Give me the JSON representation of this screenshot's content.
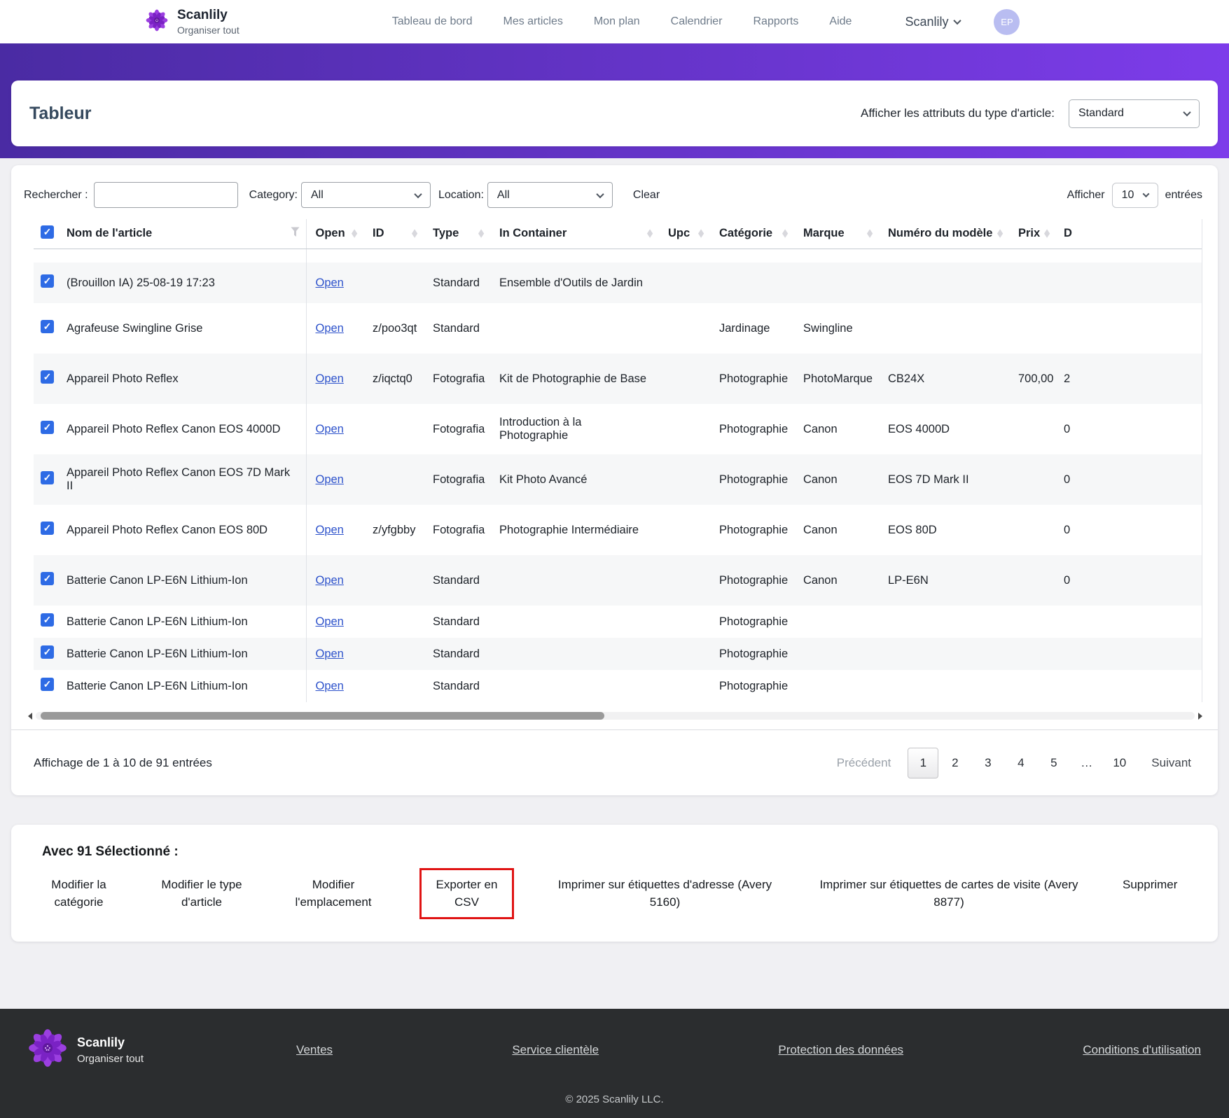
{
  "header": {
    "brand": {
      "name": "Scanlily",
      "tagline": "Organiser tout"
    },
    "nav": [
      "Tableau de bord",
      "Mes articles",
      "Mon plan",
      "Calendrier",
      "Rapports",
      "Aide"
    ],
    "account_menu": "Scanlily",
    "avatar_initials": "EP"
  },
  "page": {
    "title": "Tableur",
    "attribute_filter_label": "Afficher les attributs du type d'article:",
    "attribute_filter_value": "Standard"
  },
  "filters": {
    "search_label": "Rechercher :",
    "search_value": "",
    "category_label": "Category:",
    "category_value": "All",
    "location_label": "Location:",
    "location_value": "All",
    "clear_label": "Clear",
    "show_label": "Afficher",
    "show_value": "10",
    "entries_label": "entrées"
  },
  "table": {
    "head": {
      "name": "Nom de l'article",
      "open": "Open",
      "id": "ID",
      "type": "Type",
      "container": "In Container",
      "upc": "Upc",
      "category": "Catégorie",
      "brand": "Marque",
      "model": "Numéro du modèle",
      "price": "Prix",
      "d": "D"
    },
    "open_label": "Open",
    "rows": [
      {
        "name": "(Brouillon IA) 25-08-19 17:23",
        "id": "",
        "type": "Standard",
        "container": "Ensemble d'Outils de Jardin",
        "upc": "",
        "category": "",
        "brand": "",
        "model": "",
        "price": "",
        "d": ""
      },
      {
        "name": "Agrafeuse Swingline Grise",
        "id": "z/poo3qt",
        "type": "Standard",
        "container": "",
        "upc": "",
        "category": "Jardinage",
        "brand": "Swingline",
        "model": "",
        "price": "",
        "d": ""
      },
      {
        "name": "Appareil Photo Reflex",
        "id": "z/iqctq0",
        "type": "Fotografia",
        "container": "Kit de Photographie de Base",
        "upc": "",
        "category": "Photographie",
        "brand": "PhotoMarque",
        "model": "CB24X",
        "price": "700,00",
        "d": "2"
      },
      {
        "name": "Appareil Photo Reflex Canon EOS 4000D",
        "id": "",
        "type": "Fotografia",
        "container": "Introduction à la Photographie",
        "upc": "",
        "category": "Photographie",
        "brand": "Canon",
        "model": "EOS 4000D",
        "price": "",
        "d": "0"
      },
      {
        "name": "Appareil Photo Reflex Canon EOS 7D Mark II",
        "id": "",
        "type": "Fotografia",
        "container": "Kit Photo Avancé",
        "upc": "",
        "category": "Photographie",
        "brand": "Canon",
        "model": "EOS 7D Mark II",
        "price": "",
        "d": "0"
      },
      {
        "name": "Appareil Photo Reflex Canon EOS 80D",
        "id": "z/yfgbby",
        "type": "Fotografia",
        "container": "Photographie Intermédiaire",
        "upc": "",
        "category": "Photographie",
        "brand": "Canon",
        "model": "EOS 80D",
        "price": "",
        "d": "0"
      },
      {
        "name": "Batterie Canon LP-E6N Lithium-Ion",
        "id": "",
        "type": "Standard",
        "container": "",
        "upc": "",
        "category": "Photographie",
        "brand": "Canon",
        "model": "LP-E6N",
        "price": "",
        "d": "0"
      },
      {
        "name": "Batterie Canon LP-E6N Lithium-Ion",
        "id": "",
        "type": "Standard",
        "container": "",
        "upc": "",
        "category": "Photographie",
        "brand": "",
        "model": "",
        "price": "",
        "d": ""
      },
      {
        "name": "Batterie Canon LP-E6N Lithium-Ion",
        "id": "",
        "type": "Standard",
        "container": "",
        "upc": "",
        "category": "Photographie",
        "brand": "",
        "model": "",
        "price": "",
        "d": ""
      },
      {
        "name": "Batterie Canon LP-E6N Lithium-Ion",
        "id": "",
        "type": "Standard",
        "container": "",
        "upc": "",
        "category": "Photographie",
        "brand": "",
        "model": "",
        "price": "",
        "d": ""
      }
    ]
  },
  "pagination": {
    "summary": "Affichage de 1 à 10 de 91 entrées",
    "prev": "Précédent",
    "current": "1",
    "others": [
      "2",
      "3",
      "4",
      "5",
      "…",
      "10"
    ],
    "next": "Suivant"
  },
  "actions": {
    "heading": "Avec 91 Sélectionné :",
    "items": [
      "Modifier la catégorie",
      "Modifier le type d'article",
      "Modifier l'emplacement",
      "Exporter en CSV",
      "Imprimer sur étiquettes d'adresse (Avery 5160)",
      "Imprimer sur étiquettes de cartes de visite (Avery 8877)",
      "Supprimer"
    ],
    "highlighted_item": "Exporter en CSV"
  },
  "footer": {
    "brand": "Scanlily",
    "tagline": "Organiser tout",
    "links": [
      "Ventes",
      "Service clientèle",
      "Protection des données",
      "Conditions d'utilisation"
    ],
    "copyright": "© 2025 Scanlily LLC."
  },
  "icons": {
    "flower-logo": "purple dahlia flower",
    "chevron-down-icon": "∨",
    "sort-icon": "◆",
    "filter-icon": "funnel",
    "checkbox-checked": "blue square with white check"
  },
  "colors": {
    "banner_gradient_start": "#4a2ba3",
    "banner_gradient_end": "#7d3cea",
    "brand_purple": "#8a2be2",
    "link_blue": "#2d52cb",
    "checkbox_blue": "#2e6be5",
    "highlight_red": "#e01414",
    "footer_bg": "#2b2d2f",
    "row_stripe": "#f6f7f8"
  }
}
